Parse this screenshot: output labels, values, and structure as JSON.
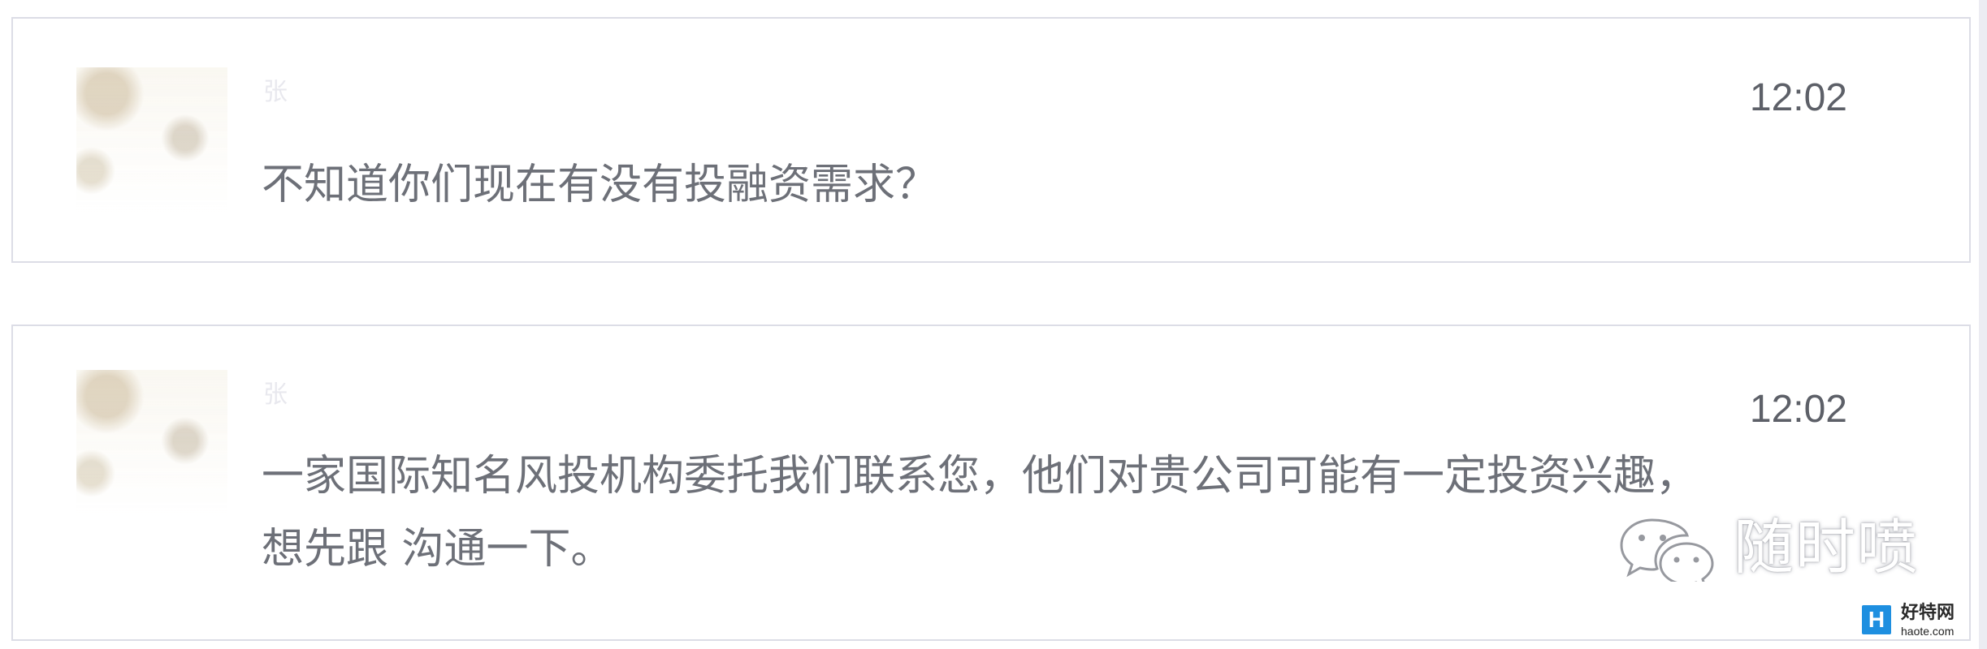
{
  "messages": [
    {
      "sender": "张",
      "time": "12:02",
      "text": "不知道你们现在有没有投融资需求？"
    },
    {
      "sender": "张",
      "time": "12:02",
      "text_line1": "一家国际知名风投机构委托我们联系您，他们对贵公司可能有一定投资兴趣，",
      "text_line2": "想先跟    沟通一下。"
    }
  ],
  "watermark": {
    "label": "随时喷"
  },
  "site_logo": {
    "glyph": "H",
    "name": "好特网",
    "url": "haote.com",
    "brand_color": "#1e8fe0"
  },
  "icons": {
    "avatar": "avatar-image",
    "wechat": "wechat-icon"
  }
}
